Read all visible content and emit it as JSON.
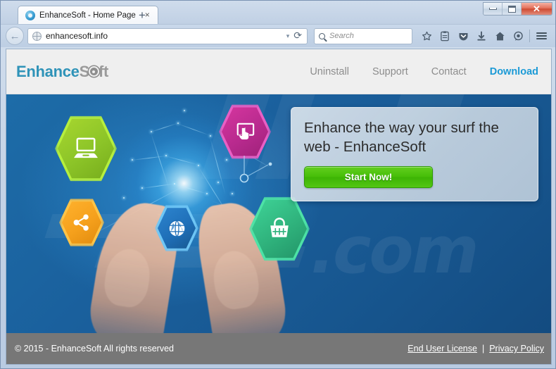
{
  "browser": {
    "tab": {
      "title": "EnhanceSoft - Home Page",
      "close_label": "×",
      "favicon": "globe-favicon"
    },
    "new_tab_label": "+",
    "window_controls": {
      "minimize": "minimize-button",
      "maximize": "maximize-button",
      "close": "✕"
    },
    "back_label": "←",
    "url": "enhancesoft.info",
    "url_dropdown": "▾",
    "reload_label": "⟳",
    "search_placeholder": "Search",
    "toolbar_icons": [
      "bookmark-star-icon",
      "reading-list-icon",
      "pocket-icon",
      "downloads-icon",
      "home-icon",
      "sync-chat-icon",
      "menu-hamburger-icon"
    ]
  },
  "site": {
    "logo": {
      "part1": "Enhance",
      "part2": "S",
      "part3": "ft"
    },
    "nav": [
      {
        "label": "Uninstall",
        "active": false
      },
      {
        "label": "Support",
        "active": false
      },
      {
        "label": "Contact",
        "active": false
      },
      {
        "label": "Download",
        "active": true
      }
    ],
    "hero": {
      "heading": "Enhance the way your surf the web - EnhanceSoft",
      "cta_label": "Start Now!",
      "watermark": ".com",
      "icons": [
        {
          "name": "laptop-hexagon-icon",
          "color": "#8cc428"
        },
        {
          "name": "touchscreen-hexagon-icon",
          "color": "#b82a8e"
        },
        {
          "name": "share-hexagon-icon",
          "color": "#f5a01c"
        },
        {
          "name": "globe-hexagon-icon",
          "color": "#1f6fb8"
        },
        {
          "name": "shopping-basket-hexagon-icon",
          "color": "#2fb27c"
        }
      ]
    },
    "footer": {
      "copyright": "© 2015 - EnhanceSoft All rights reserved",
      "links": [
        {
          "label": "End User License"
        },
        {
          "label": "Privacy Policy"
        }
      ],
      "separator": "|"
    }
  },
  "colors": {
    "accent_blue": "#1b9ad6",
    "logo_teal": "#2f93b8",
    "logo_gray": "#9b9b9b",
    "cta_green": "#45bd08",
    "hero_blue": "#1a5f9c",
    "footer_gray": "#777777"
  }
}
